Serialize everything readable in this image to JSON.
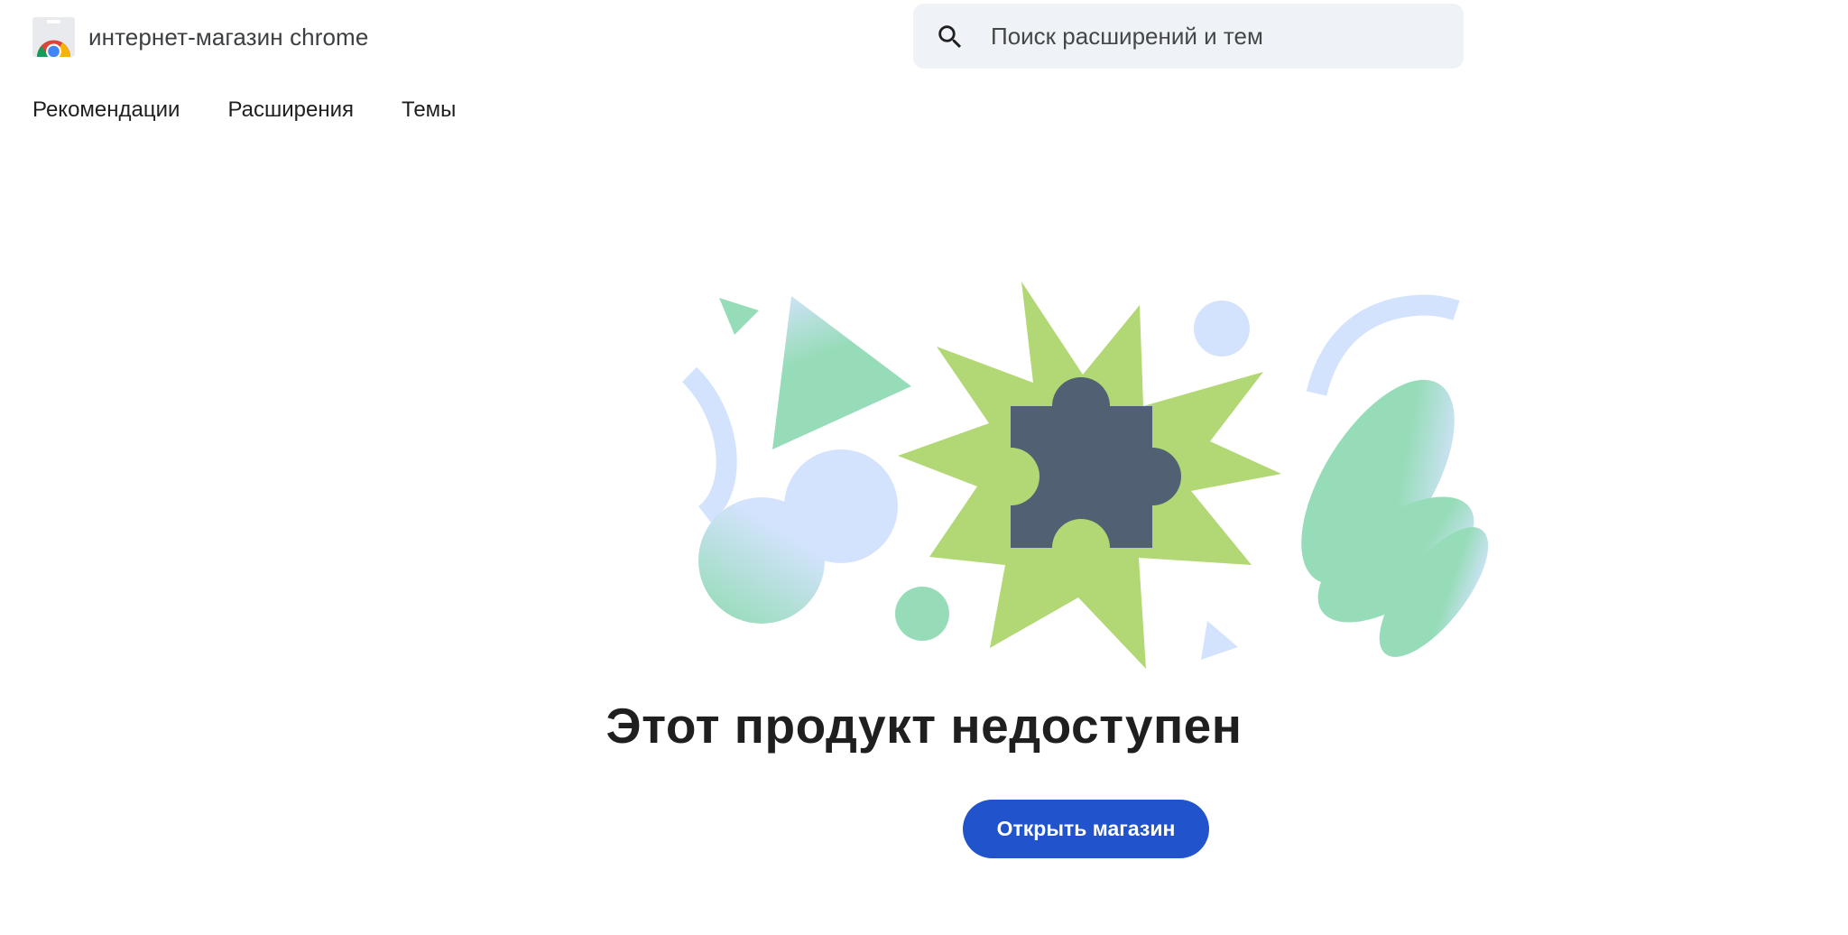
{
  "header": {
    "brand_name": "интернет-магазин chrome",
    "logo_icon": "chrome-web-store-logo-icon",
    "search": {
      "placeholder": "Поиск расширений и тем",
      "value": "",
      "icon": "search-icon"
    }
  },
  "nav": {
    "items": [
      {
        "label": "Рекомендации"
      },
      {
        "label": "Расширения"
      },
      {
        "label": "Темы"
      }
    ]
  },
  "main": {
    "illustration_icon": "puzzle-piece-icon",
    "title": "Этот продукт недоступен",
    "open_store_label": "Открыть магазин"
  },
  "colors": {
    "accent_button": "#2153cd",
    "light_blue_shape": "#d3e3fd",
    "mint_shape": "#97dcb9",
    "lime_starburst": "#b1d874",
    "puzzle_piece": "#516072",
    "search_background": "#eff3f8"
  }
}
